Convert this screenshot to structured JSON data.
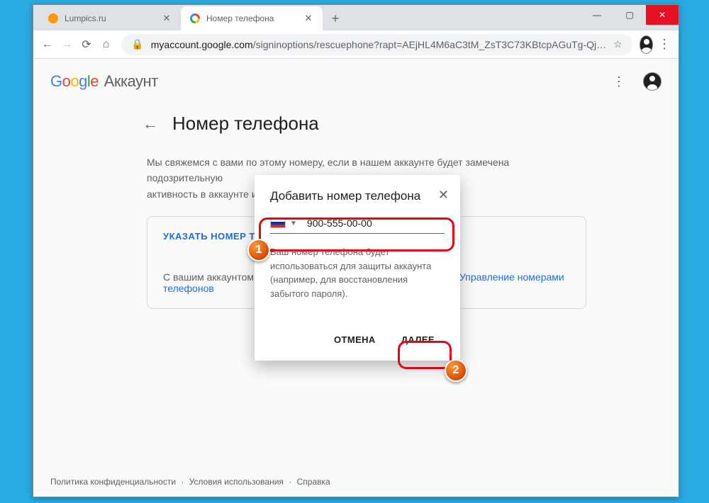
{
  "tabs": [
    {
      "title": "Lumpics.ru",
      "icon": "orange"
    },
    {
      "title": "Номер телефона",
      "icon": "google"
    }
  ],
  "url": {
    "host": "myaccount.google.com",
    "path": "/signinoptions/rescuephone?rapt=AEjHL4M6aC3tM_ZsT3C73KBtcpAGuTg-Qj…"
  },
  "header": {
    "logo_plain": "Google",
    "account_label": "Аккаунт"
  },
  "page": {
    "back_icon": "←",
    "title": "Номер телефона",
    "desc_line1": "Мы свяжемся с вами по этому номеру, если в нашем аккаунте будет замечена подозрительную",
    "desc_line2": "активность в аккаунте или вы случайно потеряете доступ к нему.",
    "card_action": "УКАЗАТЬ НОМЕР ТЕЛЕФОНА",
    "card_sub_prefix": "С вашим аккаунтом Google связаны другие номера телефонов. ",
    "card_sub_link": "Управление номерами телефонов"
  },
  "modal": {
    "title": "Добавить номер телефона",
    "phone_value": "900-555-00-00",
    "desc": "Ваш номер телефона будет использоваться для защиты аккаунта (например, для восстановления забытого пароля).",
    "cancel": "ОТМЕНА",
    "next": "ДАЛЕЕ"
  },
  "footer": {
    "privacy": "Политика конфиденциальности",
    "terms": "Условия использования",
    "help": "Справка",
    "sep": " · "
  },
  "annot": {
    "n1": "1",
    "n2": "2"
  }
}
